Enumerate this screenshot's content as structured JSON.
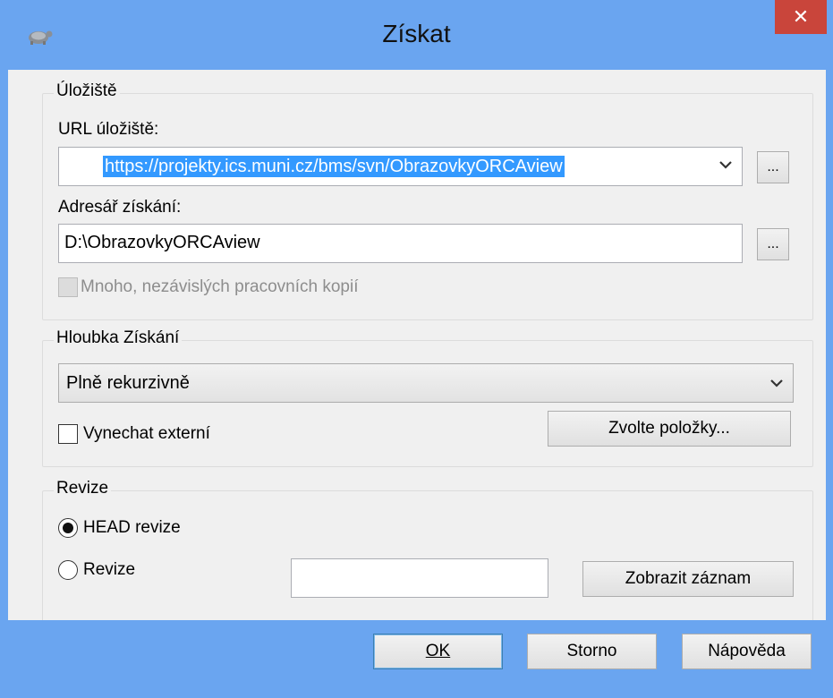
{
  "window": {
    "title": "Získat",
    "close_glyph": "✕",
    "icon": "tortoise-svn-icon"
  },
  "repository": {
    "legend": "Úložiště",
    "url_label": "URL úložiště:",
    "url_value": "https://projekty.ics.muni.cz/bms/svn/ObrazovkyORCAview",
    "browse_label": "...",
    "dir_label": "Adresář získání:",
    "dir_value": "D:\\ObrazovkyORCAview",
    "multiple_label": "Mnoho, nezávislých pracovních kopií"
  },
  "depth": {
    "legend": "Hloubka Získání",
    "selected": "Plně rekurzivně",
    "omit_externals_label": "Vynechat externí",
    "choose_items_label": "Zvolte položky..."
  },
  "revision": {
    "legend": "Revize",
    "head_label": "HEAD revize",
    "revision_label": "Revize",
    "revision_value": "",
    "show_log_label": "Zobrazit záznam"
  },
  "buttons": {
    "ok": "OK",
    "cancel": "Storno",
    "help": "Nápověda"
  }
}
